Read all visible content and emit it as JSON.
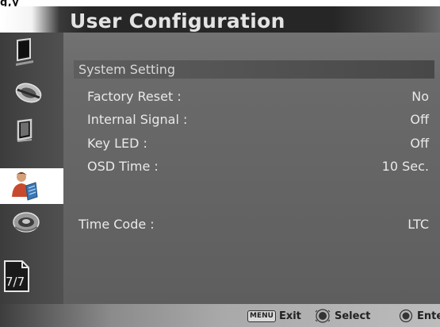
{
  "corner_fragment": "g,y",
  "header": {
    "title": "User Configuration"
  },
  "sidebar": {
    "items": [
      {
        "icon": "monitor-icon"
      },
      {
        "icon": "color-wheel-icon"
      },
      {
        "icon": "screen-icon"
      },
      {
        "icon": "user-config-icon"
      },
      {
        "icon": "speaker-icon"
      },
      {
        "icon": "page-indicator-icon",
        "label": "7/7"
      }
    ],
    "active_index": 3
  },
  "main": {
    "section_title": "System Setting",
    "settings": [
      {
        "label": "Factory Reset :",
        "value": "No"
      },
      {
        "label": "Internal Signal :",
        "value": "Off"
      },
      {
        "label": "Key LED :",
        "value": "Off"
      },
      {
        "label": "OSD Time :",
        "value": "10 Sec."
      }
    ],
    "time_code": {
      "label": "Time Code :",
      "value": "LTC"
    }
  },
  "footer": {
    "menu_key": "MENU",
    "exit_label": "Exit",
    "select_label": "Select",
    "enter_label": "Enter"
  }
}
